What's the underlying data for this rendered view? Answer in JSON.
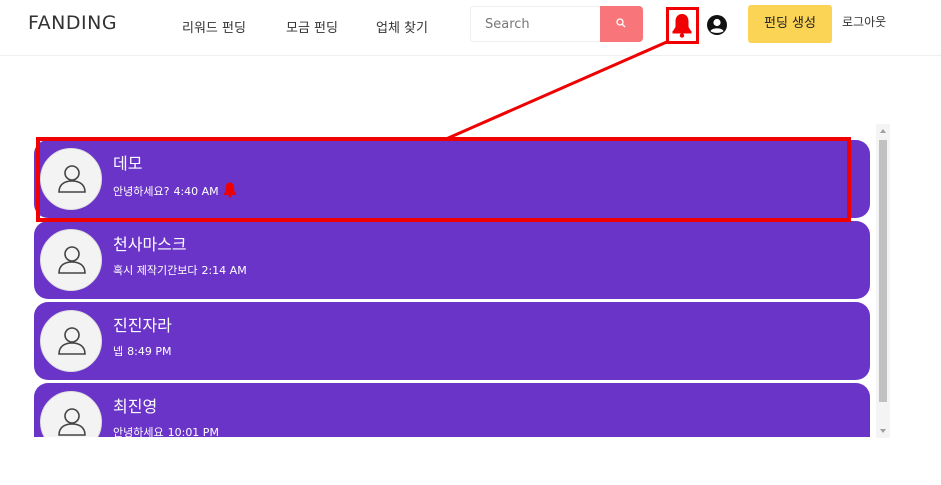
{
  "navbar": {
    "brand": "FANDING",
    "links": [
      "리워드 펀딩",
      "모금 펀딩",
      "업체 찾기"
    ],
    "search": {
      "placeholder": "Search",
      "value": ""
    },
    "icons": {
      "search": "search-icon",
      "notifications": "bell-icon",
      "account": "user-circle-icon"
    },
    "create_label": "펀딩 생성",
    "logout_label": "로그아웃"
  },
  "chats": [
    {
      "name": "데모",
      "preview": "안녕하세요?",
      "time": "4:40 AM",
      "unread_icon": "bell-icon"
    },
    {
      "name": "천사마스크",
      "preview": "혹시 제작기간보다",
      "time": "2:14 AM"
    },
    {
      "name": "진진자라",
      "preview": "넵",
      "time": "8:49 PM"
    },
    {
      "name": "최진영",
      "preview": "안녕하세요",
      "time": "10:01 PM"
    }
  ],
  "colors": {
    "chat_bg": "#6a34c8",
    "search_button": "#f8757a",
    "create_button": "#fbd355",
    "highlight": "#f00000",
    "bell": "#f00000"
  }
}
